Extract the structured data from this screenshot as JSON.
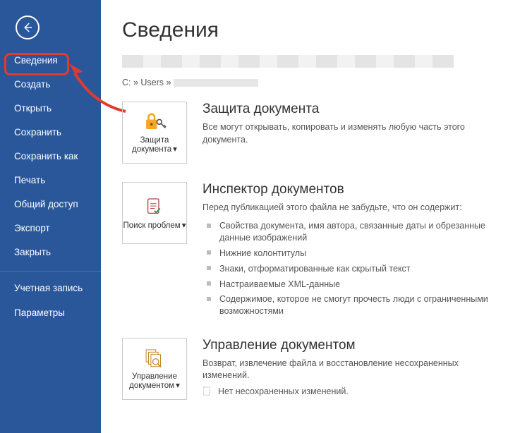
{
  "sidebar": {
    "items": [
      {
        "label": "Сведения"
      },
      {
        "label": "Создать"
      },
      {
        "label": "Открыть"
      },
      {
        "label": "Сохранить"
      },
      {
        "label": "Сохранить как"
      },
      {
        "label": "Печать"
      },
      {
        "label": "Общий доступ"
      },
      {
        "label": "Экспорт"
      },
      {
        "label": "Закрыть"
      },
      {
        "label": "Учетная запись"
      },
      {
        "label": "Параметры"
      }
    ]
  },
  "main": {
    "title": "Сведения",
    "path_prefix": "C: » Users »",
    "protect": {
      "tile_label": "Защита документа",
      "title": "Защита документа",
      "desc": "Все могут открывать, копировать и изменять любую часть этого документа."
    },
    "inspect": {
      "tile_label": "Поиск проблем",
      "title": "Инспектор документов",
      "desc": "Перед публикацией этого файла не забудьте, что он содержит:",
      "items": [
        "Свойства документа, имя автора, связанные даты и обрезанные данные изображений",
        "Нижние колонтитулы",
        "Знаки, отформатированные как скрытый текст",
        "Настраиваемые XML-данные",
        "Содержимое, которое не смогут прочесть люди с ограниченными возможностями"
      ]
    },
    "manage": {
      "tile_label": "Управление документом",
      "title": "Управление документом",
      "desc": "Возврат, извлечение файла и восстановление несохраненных изменений.",
      "unsaved": "Нет несохраненных изменений."
    }
  }
}
